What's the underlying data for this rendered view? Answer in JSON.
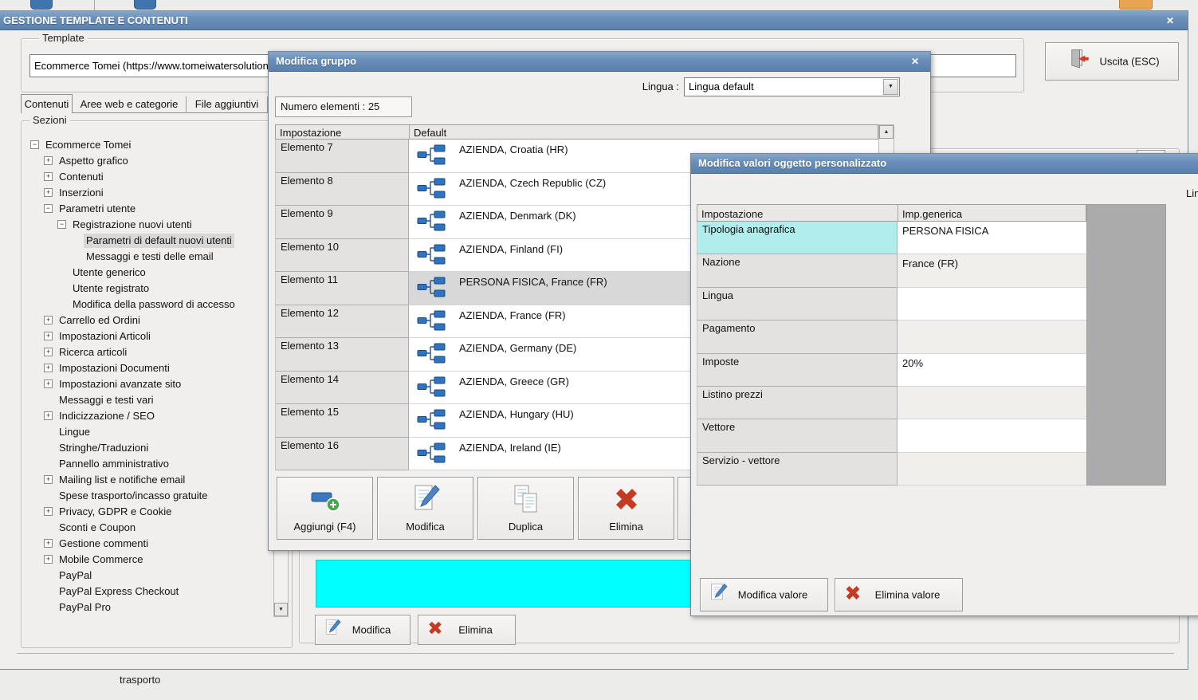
{
  "desktop": {
    "status_label": "trasporto",
    "toolbar_icons": [
      "blue-app-icon",
      "blue-app-icon",
      "orange-folder-icon"
    ]
  },
  "main_window": {
    "title": "GESTIONE TEMPLATE E CONTENUTI",
    "close_glyph": "✕",
    "template_group": {
      "label": "Template",
      "value": "Ecommerce Tomei (https://www.tomeiwatersolution"
    },
    "tabs": [
      {
        "label": "Contenuti",
        "active": true
      },
      {
        "label": "Aree web e categorie",
        "active": false
      },
      {
        "label": "File aggiuntivi",
        "active": false
      }
    ],
    "exit_button": {
      "label": "Uscita (ESC)",
      "icon": "exit-door-icon"
    },
    "sections": {
      "label": "Sezioni",
      "items": [
        {
          "text": "Ecommerce Tomei",
          "level": 0,
          "glyph": "-"
        },
        {
          "text": "Aspetto grafico",
          "level": 1,
          "glyph": "+"
        },
        {
          "text": "Contenuti",
          "level": 1,
          "glyph": "+"
        },
        {
          "text": "Inserzioni",
          "level": 1,
          "glyph": "+"
        },
        {
          "text": "Parametri utente",
          "level": 1,
          "glyph": "-"
        },
        {
          "text": "Registrazione nuovi utenti",
          "level": 2,
          "glyph": "-"
        },
        {
          "text": "Parametri di default nuovi utenti",
          "level": 3,
          "glyph": "",
          "selected": true
        },
        {
          "text": "Messaggi e testi delle email",
          "level": 3,
          "glyph": ""
        },
        {
          "text": "Utente generico",
          "level": 2,
          "glyph": ""
        },
        {
          "text": "Utente registrato",
          "level": 2,
          "glyph": ""
        },
        {
          "text": "Modifica della password di accesso",
          "level": 2,
          "glyph": ""
        },
        {
          "text": "Carrello ed Ordini",
          "level": 1,
          "glyph": "+"
        },
        {
          "text": "Impostazioni Articoli",
          "level": 1,
          "glyph": "+"
        },
        {
          "text": "Ricerca articoli",
          "level": 1,
          "glyph": "+"
        },
        {
          "text": "Impostazioni Documenti",
          "level": 1,
          "glyph": "+"
        },
        {
          "text": "Impostazioni avanzate sito",
          "level": 1,
          "glyph": "+"
        },
        {
          "text": "Messaggi e testi vari",
          "level": 1,
          "glyph": ""
        },
        {
          "text": "Indicizzazione / SEO",
          "level": 1,
          "glyph": "+"
        },
        {
          "text": "Lingue",
          "level": 1,
          "glyph": ""
        },
        {
          "text": "Stringhe/Traduzioni",
          "level": 1,
          "glyph": ""
        },
        {
          "text": "Pannello amministrativo",
          "level": 1,
          "glyph": ""
        },
        {
          "text": "Mailing list e notifiche email",
          "level": 1,
          "glyph": "+"
        },
        {
          "text": "Spese trasporto/incasso gratuite",
          "level": 1,
          "glyph": ""
        },
        {
          "text": "Privacy, GDPR e Cookie",
          "level": 1,
          "glyph": "+"
        },
        {
          "text": "Sconti e Coupon",
          "level": 1,
          "glyph": ""
        },
        {
          "text": "Gestione commenti",
          "level": 1,
          "glyph": "+"
        },
        {
          "text": "Mobile Commerce",
          "level": 1,
          "glyph": "+"
        },
        {
          "text": "PayPal",
          "level": 1,
          "glyph": ""
        },
        {
          "text": "PayPal Express Checkout",
          "level": 1,
          "glyph": ""
        },
        {
          "text": "PayPal Pro",
          "level": 1,
          "glyph": ""
        }
      ]
    },
    "bottom_buttons": [
      {
        "label": "Modifica",
        "icon": "edit-icon"
      },
      {
        "label": "Elimina",
        "icon": "delete-x-icon"
      }
    ]
  },
  "dialog_modifica_gruppo": {
    "title": "Modifica gruppo",
    "close_glyph": "✕",
    "lingua_label": "Lingua :",
    "lingua_value": "Lingua default",
    "numero_elementi": "Numero elementi : 25",
    "table": {
      "columns": [
        "Impostazione",
        "Default"
      ],
      "row_icon": "hierarchy-icon",
      "rows": [
        {
          "name": "Elemento 7",
          "value": "AZIENDA, Croatia (HR)"
        },
        {
          "name": "Elemento 8",
          "value": "AZIENDA, Czech Republic (CZ)"
        },
        {
          "name": "Elemento 9",
          "value": "AZIENDA, Denmark (DK)"
        },
        {
          "name": "Elemento 10",
          "value": "AZIENDA, Finland (FI)"
        },
        {
          "name": "Elemento 11",
          "value": "PERSONA FISICA, France (FR)",
          "selected": true
        },
        {
          "name": "Elemento 12",
          "value": "AZIENDA, France (FR)"
        },
        {
          "name": "Elemento 13",
          "value": "AZIENDA, Germany (DE)"
        },
        {
          "name": "Elemento 14",
          "value": "AZIENDA, Greece (GR)"
        },
        {
          "name": "Elemento 15",
          "value": "AZIENDA, Hungary (HU)"
        },
        {
          "name": "Elemento 16",
          "value": "AZIENDA, Ireland (IE)"
        }
      ]
    },
    "buttons": [
      {
        "label": "Aggiungi (F4)",
        "icon": "add-icon"
      },
      {
        "label": "Modifica",
        "icon": "edit-icon"
      },
      {
        "label": "Duplica",
        "icon": "copy-icon"
      },
      {
        "label": "Elimina",
        "icon": "delete-x-icon"
      }
    ]
  },
  "dialog_modifica_valori": {
    "title": "Modifica valori oggetto personalizzato",
    "lingua_label_partial": "Lingua :",
    "table": {
      "columns": [
        "Impostazione",
        "Imp.generica"
      ],
      "rows": [
        {
          "name": "Tipologia anagrafica",
          "value": "PERSONA FISICA",
          "highlight": true
        },
        {
          "name": "Nazione",
          "value": "France (FR)"
        },
        {
          "name": "Lingua",
          "value": ""
        },
        {
          "name": "Pagamento",
          "value": ""
        },
        {
          "name": "Imposte",
          "value": "20%"
        },
        {
          "name": "Listino prezzi",
          "value": ""
        },
        {
          "name": "Vettore",
          "value": ""
        },
        {
          "name": "Servizio - vettore",
          "value": ""
        }
      ]
    },
    "buttons": [
      {
        "label": "Modifica valore",
        "icon": "edit-icon"
      },
      {
        "label": "Elimina valore",
        "icon": "delete-x-icon"
      }
    ]
  },
  "colors": {
    "titlebar_blue": "#6990ba",
    "cyan_panel": "#00ffff",
    "highlight_cell_cyan": "#b2eded",
    "delete_red": "#c23b22",
    "icon_blue": "#2f74c0",
    "add_green": "#46a84b",
    "selected_row_gray": "#d8d8d8"
  }
}
